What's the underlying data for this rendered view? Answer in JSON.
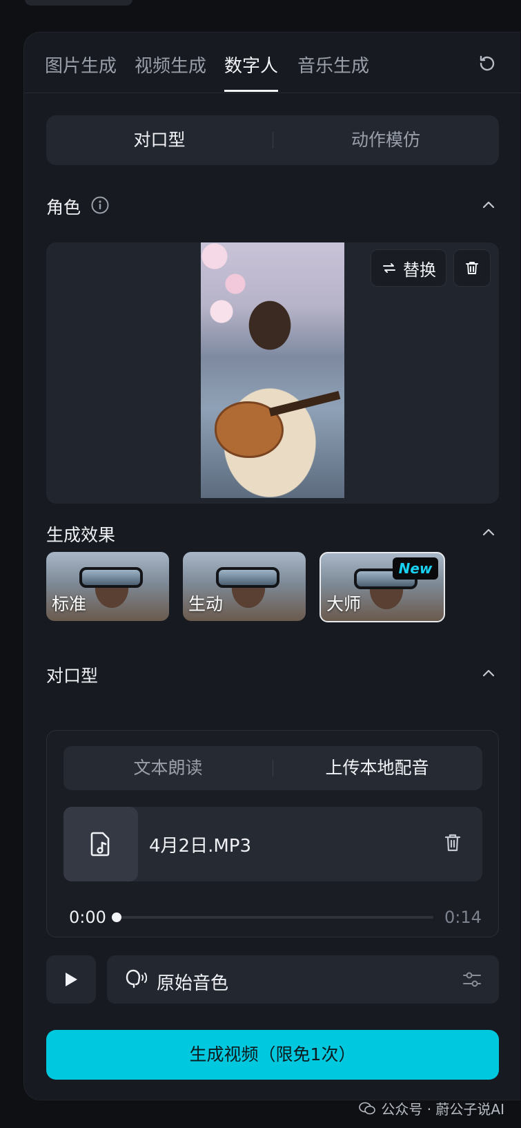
{
  "tabs": [
    {
      "label": "图片生成"
    },
    {
      "label": "视频生成"
    },
    {
      "label": "数字人",
      "active": true
    },
    {
      "label": "音乐生成"
    }
  ],
  "mode_switch": {
    "options": [
      "对口型",
      "动作模仿"
    ],
    "selected": "对口型"
  },
  "role_section": {
    "title": "角色",
    "replace_label": "替换"
  },
  "effect_section": {
    "title": "生成效果",
    "options": [
      {
        "label": "标准"
      },
      {
        "label": "生动"
      },
      {
        "label": "大师",
        "badge": "New",
        "selected": true
      }
    ]
  },
  "lipsync_section": {
    "title": "对口型",
    "source_options": [
      "文本朗读",
      "上传本地配音"
    ],
    "selected_source": "上传本地配音",
    "file": {
      "name": "4月2日.MP3"
    },
    "player": {
      "current": "0:00",
      "duration": "0:14",
      "progress": 0.0
    }
  },
  "voice": {
    "label": "原始音色"
  },
  "generate_button": {
    "label": "生成视频（限免1次）"
  },
  "watermark": {
    "text": "公众号 · 蔚公子说AI"
  },
  "colors": {
    "accent": "#00c8df",
    "panel": "#171a20",
    "card": "#21252d",
    "badge_text": "#19d0f0"
  }
}
